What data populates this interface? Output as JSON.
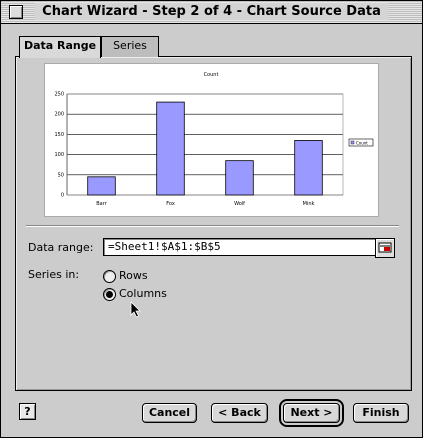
{
  "window": {
    "title": "Chart Wizard - Step 2 of 4 - Chart Source Data"
  },
  "tabs": [
    {
      "label": "Data Range",
      "active": true
    },
    {
      "label": "Series",
      "active": false
    }
  ],
  "chart_data": {
    "type": "bar",
    "title": "Count",
    "categories": [
      "Barr",
      "Fox",
      "Wolf",
      "Mink"
    ],
    "series": [
      {
        "name": "Count",
        "values": [
          45,
          230,
          85,
          135
        ],
        "color": "#9999ff"
      }
    ],
    "ylim": [
      0,
      250
    ],
    "yticks": [
      0,
      50,
      100,
      150,
      200,
      250
    ],
    "grid": true,
    "legend": "right"
  },
  "form": {
    "data_range_label": "Data range:",
    "data_range_value": "=Sheet1!$A$1:$B$5",
    "series_in_label": "Series in:",
    "options": [
      {
        "label": "Rows",
        "checked": false
      },
      {
        "label": "Columns",
        "checked": true
      }
    ]
  },
  "buttons": {
    "help": "?",
    "cancel": "Cancel",
    "back": "< Back",
    "next": "Next >",
    "finish": "Finish"
  },
  "icons": {
    "close": "close-box-icon",
    "collapse": "collapse-dialog-icon",
    "cursor": "arrow-cursor-icon",
    "help": "help-icon"
  }
}
